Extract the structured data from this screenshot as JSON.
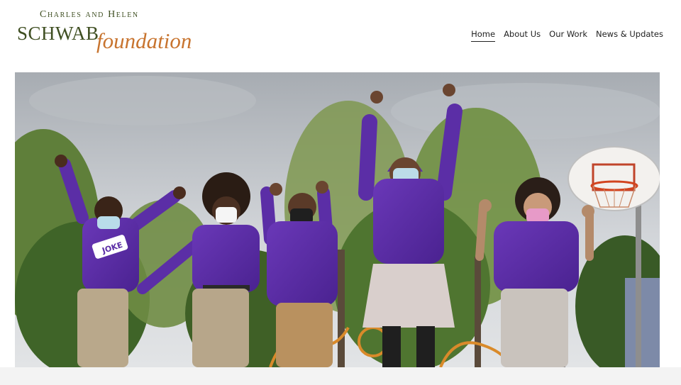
{
  "logo": {
    "line1": "Charles and Helen",
    "line2": "SCHWAB",
    "line3": "foundation"
  },
  "nav": {
    "items": [
      {
        "label": "Home",
        "active": true
      },
      {
        "label": "About Us",
        "active": false
      },
      {
        "label": "Our Work",
        "active": false
      },
      {
        "label": "News & Updates",
        "active": false
      }
    ]
  },
  "hero": {
    "shirt_text": "JOKE"
  },
  "colors": {
    "logo_green": "#3f4f22",
    "logo_orange": "#c8742f",
    "purple": "#5b2ea6"
  }
}
